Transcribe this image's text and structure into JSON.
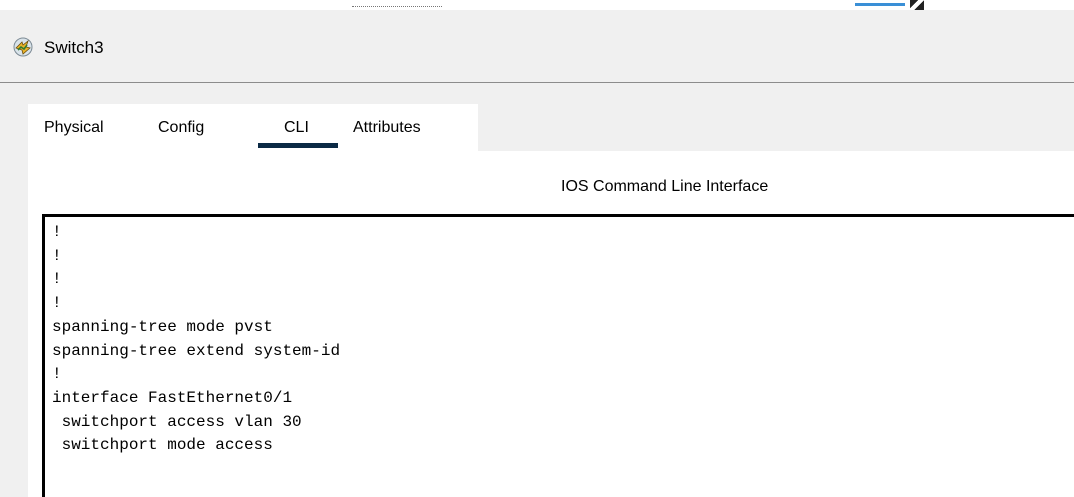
{
  "window": {
    "title": "Switch3"
  },
  "tabs": [
    {
      "label": "Physical",
      "active": false
    },
    {
      "label": "Config",
      "active": false
    },
    {
      "label": "CLI",
      "active": true
    },
    {
      "label": "Attributes",
      "active": false
    }
  ],
  "cli": {
    "header": "IOS Command Line Interface",
    "lines": [
      "!",
      "!",
      "!",
      "!",
      "spanning-tree mode pvst",
      "spanning-tree extend system-id",
      "!",
      "interface FastEthernet0/1",
      " switchport access vlan 30",
      " switchport mode access"
    ]
  },
  "icons": {
    "app": "switch-device-icon"
  },
  "colors": {
    "active_tab_indicator": "#0b2a45",
    "window_bg": "#f0f0f0",
    "panel_bg": "#ffffff"
  }
}
